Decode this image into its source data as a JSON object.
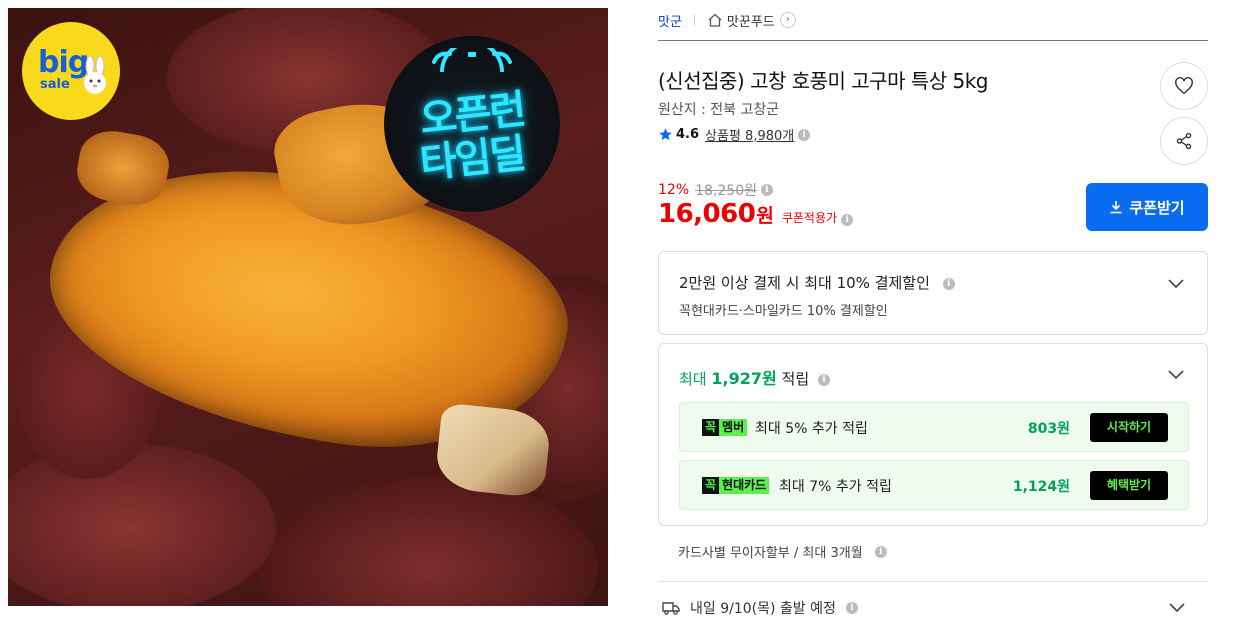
{
  "image": {
    "badge_big": "big",
    "badge_sale": "sale",
    "timedeal_line1": "오픈런",
    "timedeal_line2": "타임딜"
  },
  "breadcrumb": {
    "category": "맛군",
    "store": "맛꾼푸드"
  },
  "product": {
    "title": "(신선집중) 고창 호풍미 고구마 특상 5kg",
    "origin": "원산지 : 전북 고창군",
    "rating": "4.6",
    "reviews": "상품평 8,980개"
  },
  "price": {
    "discount_rate": "12%",
    "original": "18,250원",
    "sale_price": "16,060",
    "unit": "원",
    "coupon_note": "쿠폰적용가",
    "coupon_button": "쿠폰받기"
  },
  "card_discount": {
    "headline": "2만원 이상 결제 시 최대 10% 결제할인",
    "detail": "꼭현대카드·스마일카드 10% 결제할인"
  },
  "points": {
    "prefix": "최대",
    "amount": "1,927원",
    "suffix": "적립",
    "rows": [
      {
        "tag_k": "꼭",
        "tag_label": "멤버",
        "desc": "최대 5% 추가 적립",
        "amount": "803원",
        "action": "시작하기"
      },
      {
        "tag_k": "꼭",
        "tag_label": "현대카드",
        "desc": "최대 7% 추가 적립",
        "amount": "1,124원",
        "action": "혜택받기"
      }
    ]
  },
  "installment": "카드사별 무이자할부 / 최대 3개월",
  "shipping": "내일 9/10(목) 출발 예정",
  "colors": {
    "accent_blue": "#0a6cf0",
    "price_red": "#e00000",
    "point_green": "#00a35a",
    "neon_green": "#5cf04a"
  }
}
